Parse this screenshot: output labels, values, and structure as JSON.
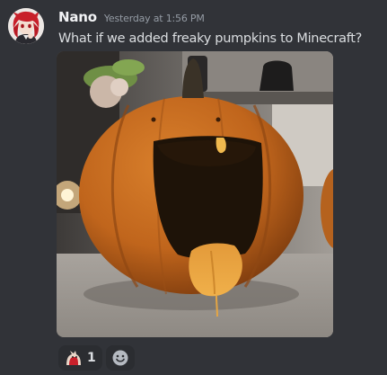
{
  "message": {
    "author": "Nano",
    "timestamp": "Yesterday at 1:56 PM",
    "text": "What if we added freaky pumpkins to Minecraft?"
  },
  "attachment": {
    "icon": "pumpkin-photo"
  },
  "reactions": [
    {
      "icon": "cat-emoji-icon",
      "count": "1"
    }
  ],
  "add_reaction": {
    "icon": "smiley-icon"
  }
}
